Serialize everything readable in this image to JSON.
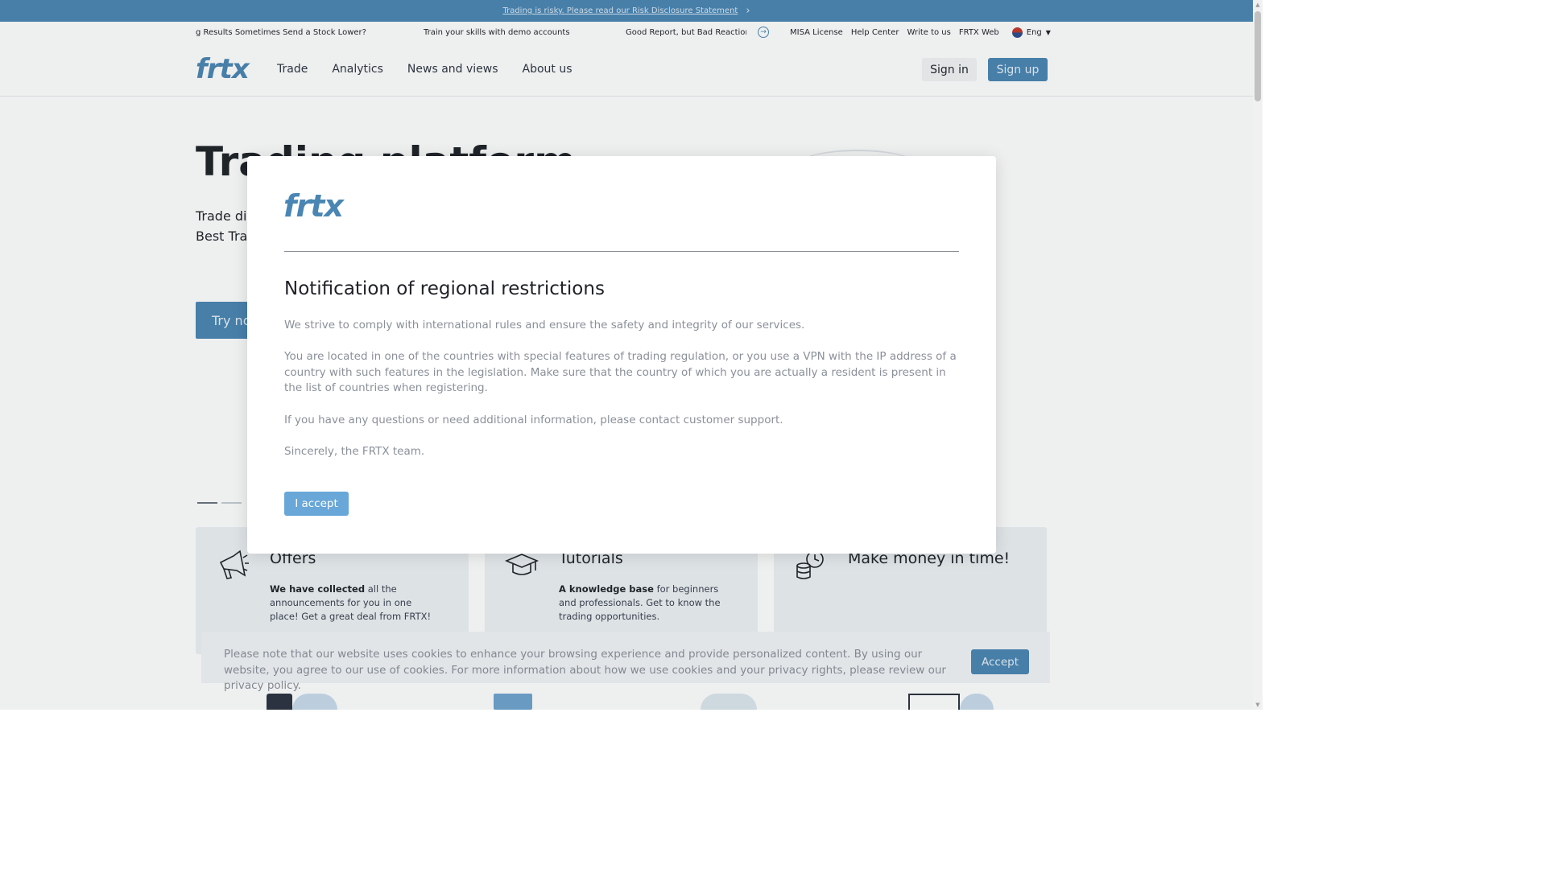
{
  "risk_banner": {
    "text": "Trading is risky. Please read our Risk Disclosure Statement"
  },
  "ticker": {
    "items": [
      "g Results Sometimes Send a Stock Lower?",
      "Train your skills with demo accounts",
      "Good Report, but Bad Reaction..."
    ]
  },
  "util_links": [
    "MISA License",
    "Help Center",
    "Write to us",
    "FRTX Web"
  ],
  "language": "Eng",
  "brand": {
    "logo_text": "frtx",
    "accent": "#4a86b4"
  },
  "nav": [
    "Trade",
    "Analytics",
    "News and views",
    "About us"
  ],
  "auth": {
    "signin": "Sign in",
    "signup": "Sign up"
  },
  "hero": {
    "title": "Trading platform",
    "subtitle_line1": "Trade di",
    "subtitle_line2": "Best Tra",
    "cta": "Try no"
  },
  "cards": [
    {
      "title": "Offers",
      "bold": "We have collected",
      "text": " all the announcements for you in one place! Get a great deal from FRTX!"
    },
    {
      "title": "Tutorials",
      "bold": "A knowledge base",
      "text": " for beginners and professionals. Get to know the trading opportunities."
    },
    {
      "title": "Make money in time!",
      "bold": "",
      "text": ""
    }
  ],
  "modal": {
    "title": "Notification of regional restrictions",
    "p1": "We strive to comply with international rules and ensure the safety and integrity of our services.",
    "p2": "You are located in one of the countries with special features of trading regulation, or you use a VPN with the IP address of a country with such features in the legislation. Make sure that the country of which you are actually a resident is present in the list of countries when registering.",
    "p3": "If you have any questions or need additional information, please contact customer support.",
    "p4": "Sincerely, the FRTX team.",
    "accept": "I accept"
  },
  "cookie": {
    "text": "Please note that our website uses cookies to enhance your browsing experience and provide personalized content. By using our website, you agree to our use of cookies. For more information about how we use cookies and your privacy rights, please review our privacy policy.",
    "accept": "Accept"
  }
}
